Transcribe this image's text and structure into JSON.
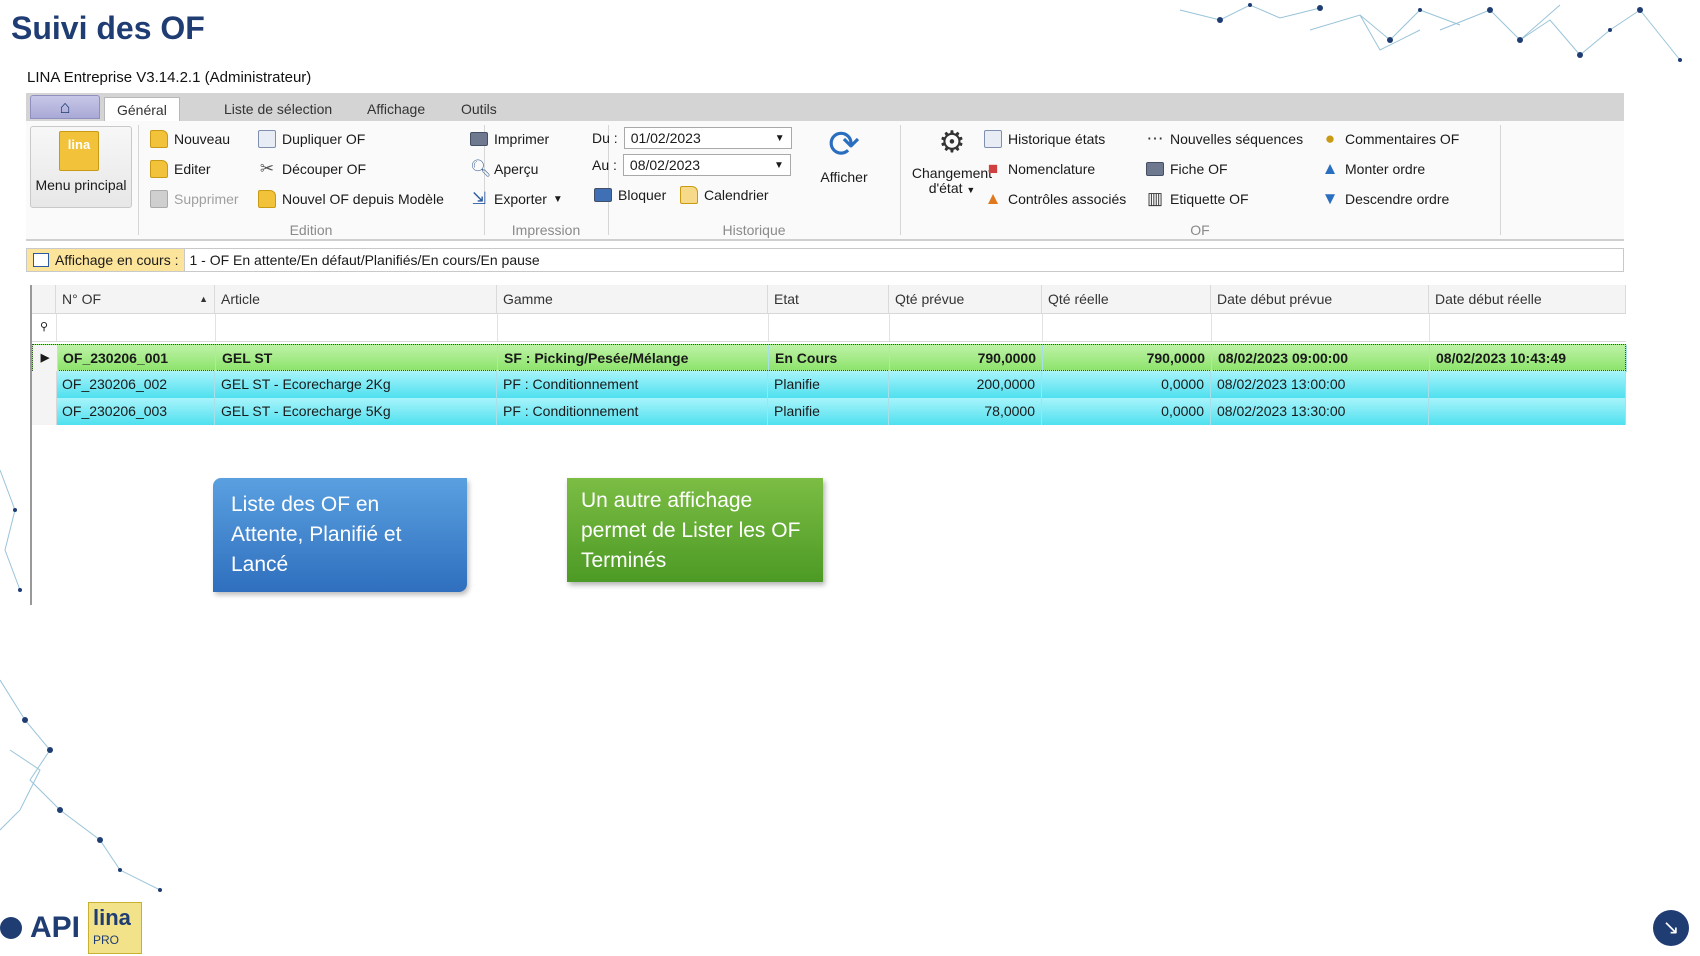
{
  "slide": {
    "title": "Suivi des OF"
  },
  "app": {
    "title": "LINA Entreprise  V3.14.2.1  (Administrateur)"
  },
  "tabs": [
    {
      "label": "Général"
    },
    {
      "label": "Liste de sélection"
    },
    {
      "label": "Affichage"
    },
    {
      "label": "Outils"
    }
  ],
  "ribbon": {
    "menu_principal": "Menu principal",
    "lina_logo_text": "lina",
    "edition": {
      "label": "Edition",
      "nouveau": "Nouveau",
      "editer": "Editer",
      "supprimer": "Supprimer",
      "dupliquer": "Dupliquer OF",
      "decouper": "Découper OF",
      "nouvel_modele": "Nouvel OF depuis Modèle"
    },
    "impression": {
      "label": "Impression",
      "imprimer": "Imprimer",
      "apercu": "Aperçu",
      "exporter": "Exporter"
    },
    "historique": {
      "label": "Historique",
      "du_label": "Du :",
      "du_value": "01/02/2023",
      "au_label": "Au :",
      "au_value": "08/02/2023",
      "bloquer": "Bloquer",
      "calendrier": "Calendrier",
      "afficher": "Afficher"
    },
    "of": {
      "label": "OF",
      "changement_line1": "Changement",
      "changement_line2": "d'état",
      "historique_etats": "Historique états",
      "nomenclature": "Nomenclature",
      "controles": "Contrôles associés",
      "nouvelles_sequences": "Nouvelles séquences",
      "fiche_of": "Fiche OF",
      "etiquette_of": "Etiquette OF",
      "commentaires": "Commentaires OF",
      "monter": "Monter ordre",
      "descendre": "Descendre ordre"
    }
  },
  "filter": {
    "label": "Affichage en cours :",
    "value": "1 - OF En attente/En défaut/Planifiés/En cours/En pause"
  },
  "grid": {
    "columns": [
      "N° OF",
      "Article",
      "Gamme",
      "Etat",
      "Qté prévue",
      "Qté réelle",
      "Date début prévue",
      "Date début réelle"
    ],
    "rows": [
      {
        "of": "OF_230206_001",
        "article": "GEL ST",
        "gamme": "SF : Picking/Pesée/Mélange",
        "etat": "En Cours",
        "qte_prevue": "790,0000",
        "qte_reelle": "790,0000",
        "date_prevue": "08/02/2023 09:00:00",
        "date_reelle": "08/02/2023 10:43:49"
      },
      {
        "of": "OF_230206_002",
        "article": "GEL ST - Ecorecharge 2Kg",
        "gamme": "PF : Conditionnement",
        "etat": "Planifie",
        "qte_prevue": "200,0000",
        "qte_reelle": "0,0000",
        "date_prevue": "08/02/2023 13:00:00",
        "date_reelle": ""
      },
      {
        "of": "OF_230206_003",
        "article": "GEL ST - Ecorecharge 5Kg",
        "gamme": "PF : Conditionnement",
        "etat": "Planifie",
        "qte_prevue": "78,0000",
        "qte_reelle": "0,0000",
        "date_prevue": "08/02/2023 13:30:00",
        "date_reelle": ""
      }
    ]
  },
  "callouts": {
    "blue": "Liste des OF en Attente, Planifié et Lancé",
    "green": "Un autre affichage permet de Lister les OF Terminés"
  },
  "brand": {
    "api": "API",
    "lina": "lina",
    "pro": "PRO"
  },
  "colors": {
    "title": "#1f3d73",
    "row_active": "#8de46c",
    "row_planned": "#4fe0ef",
    "callout_blue": "#2f6fbe",
    "callout_green": "#4c9a25"
  }
}
